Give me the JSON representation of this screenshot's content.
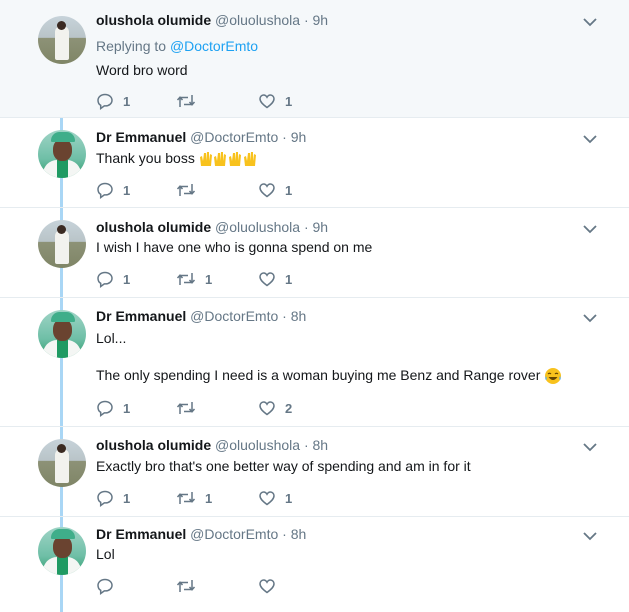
{
  "tweets": [
    {
      "name": "olushola olumide",
      "handle": "@oluolushola",
      "dot": "·",
      "time": "9h",
      "reply_prefix": "Replying to ",
      "reply_mention": "@DoctorEmto",
      "text": "Word bro word",
      "replies": "1",
      "retweets": "",
      "likes": "1"
    },
    {
      "name": "Dr Emmanuel",
      "handle": "@DoctorEmto",
      "dot": "·",
      "time": "9h",
      "text": "Thank you boss",
      "emoji": "raised-hands-emoji",
      "replies": "1",
      "retweets": "",
      "likes": "1"
    },
    {
      "name": "olushola olumide",
      "handle": "@oluolushola",
      "dot": "·",
      "time": "9h",
      "text": "I wish I have one who is gonna spend on me",
      "replies": "1",
      "retweets": "1",
      "likes": "1"
    },
    {
      "name": "Dr Emmanuel",
      "handle": "@DoctorEmto",
      "dot": "·",
      "time": "8h",
      "text": "Lol...",
      "text2": "The only spending I need is a woman buying me Benz and Range rover",
      "emoji": "tears-of-joy-emoji",
      "replies": "1",
      "retweets": "",
      "likes": "2"
    },
    {
      "name": "olushola olumide",
      "handle": "@oluolushola",
      "dot": "·",
      "time": "8h",
      "text": "Exactly bro that's one better way of spending and am in for it",
      "replies": "1",
      "retweets": "1",
      "likes": "1"
    },
    {
      "name": "Dr Emmanuel",
      "handle": "@DoctorEmto",
      "dot": "·",
      "time": "8h",
      "text": "Lol",
      "replies": "",
      "retweets": "",
      "likes": ""
    }
  ],
  "colors": {
    "accent": "#1da1f2",
    "thread_line": "#a9d6f5",
    "muted": "#657786"
  },
  "icons": {
    "reply": "reply-icon",
    "retweet": "retweet-icon",
    "like": "heart-icon",
    "menu": "chevron-down-icon"
  }
}
